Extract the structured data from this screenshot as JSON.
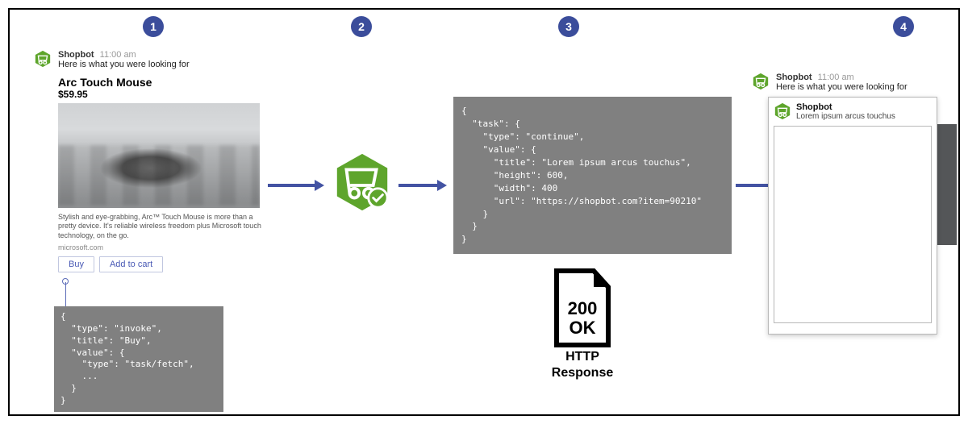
{
  "steps": {
    "s1": "1",
    "s2": "2",
    "s3": "3",
    "s4": "4"
  },
  "bot": {
    "name": "Shopbot",
    "time": "11:00 am",
    "msg": "Here is what you were looking for"
  },
  "product": {
    "title": "Arc Touch Mouse",
    "price": "$59.95",
    "desc": "Stylish and eye-grabbing, Arc™ Touch Mouse is more than a pretty device. It's reliable wireless freedom plus Microsoft touch technology, on the go.",
    "domain": "microsoft.com"
  },
  "buttons": {
    "buy": "Buy",
    "cart": "Add to cart"
  },
  "code1": "{\n  \"type\": \"invoke\",\n  \"title\": \"Buy\",\n  \"value\": {\n    \"type\": \"task/fetch\",\n    ...\n  }\n}",
  "code3": "{\n  \"task\": {\n    \"type\": \"continue\",\n    \"value\": {\n      \"title\": \"Lorem ipsum arcus touchus\",\n      \"height\": 600,\n      \"width\": 400\n      \"url\": \"https://shopbot.com?item=90210\"\n    }\n  }\n}",
  "http": {
    "status": "200",
    "ok": "OK",
    "label1": "HTTP",
    "label2": "Response"
  },
  "taskModule": {
    "name": "Shopbot",
    "subtitle": "Lorem ipsum arcus touchus"
  }
}
